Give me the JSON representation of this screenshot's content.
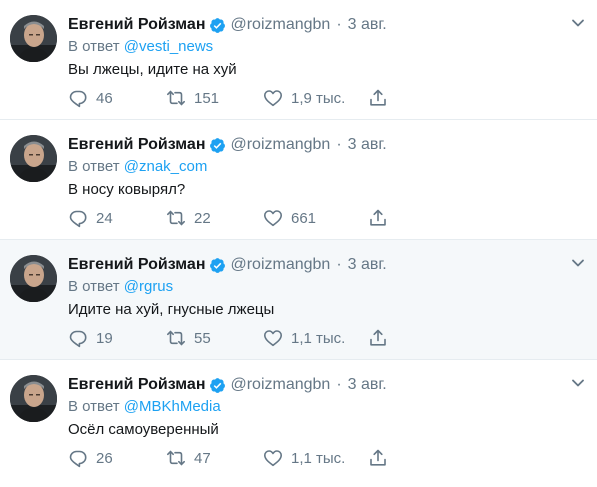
{
  "tweets": [
    {
      "author": "Евгений Ройзман",
      "handle": "@roizmangbn",
      "dot": "·",
      "date": "3 авг.",
      "reply_prefix": "В ответ",
      "reply_to": "@vesti_news",
      "text": "Вы лжецы, идите на хуй",
      "replies": "46",
      "retweets": "151",
      "likes": "1,9 тыс."
    },
    {
      "author": "Евгений Ройзман",
      "handle": "@roizmangbn",
      "dot": "·",
      "date": "3 авг.",
      "reply_prefix": "В ответ",
      "reply_to": "@znak_com",
      "text": "В носу ковырял?",
      "replies": "24",
      "retweets": "22",
      "likes": "661"
    },
    {
      "author": "Евгений Ройзман",
      "handle": "@roizmangbn",
      "dot": "·",
      "date": "3 авг.",
      "reply_prefix": "В ответ",
      "reply_to": "@rgrus",
      "text": "Идите на хуй, гнусные лжецы",
      "replies": "19",
      "retweets": "55",
      "likes": "1,1 тыс."
    },
    {
      "author": "Евгений Ройзман",
      "handle": "@roizmangbn",
      "dot": "·",
      "date": "3 авг.",
      "reply_prefix": "В ответ",
      "reply_to": "@MBKhMedia",
      "text": "Осёл самоуверенный",
      "replies": "26",
      "retweets": "47",
      "likes": "1,1 тыс."
    }
  ],
  "icons": {
    "verified": "verified-badge-icon",
    "caret": "chevron-down-icon",
    "reply": "reply-icon",
    "retweet": "retweet-icon",
    "like": "heart-icon",
    "share": "share-icon"
  },
  "colors": {
    "accent": "#1da1f2",
    "secondary_text": "#657786",
    "highlight_bg": "#f5f8fa"
  }
}
